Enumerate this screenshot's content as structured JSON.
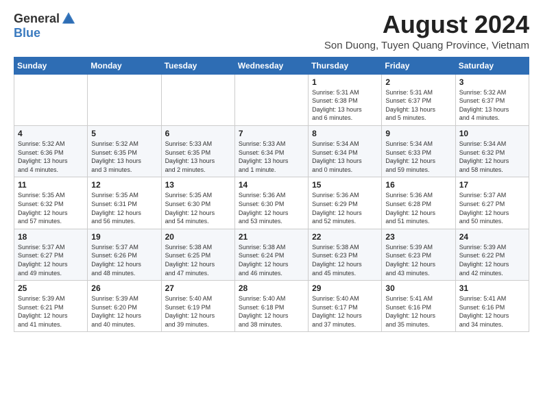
{
  "header": {
    "logo_general": "General",
    "logo_blue": "Blue",
    "month_year": "August 2024",
    "location": "Son Duong, Tuyen Quang Province, Vietnam"
  },
  "weekdays": [
    "Sunday",
    "Monday",
    "Tuesday",
    "Wednesday",
    "Thursday",
    "Friday",
    "Saturday"
  ],
  "weeks": [
    [
      {
        "day": "",
        "info": ""
      },
      {
        "day": "",
        "info": ""
      },
      {
        "day": "",
        "info": ""
      },
      {
        "day": "",
        "info": ""
      },
      {
        "day": "1",
        "info": "Sunrise: 5:31 AM\nSunset: 6:38 PM\nDaylight: 13 hours\nand 6 minutes."
      },
      {
        "day": "2",
        "info": "Sunrise: 5:31 AM\nSunset: 6:37 PM\nDaylight: 13 hours\nand 5 minutes."
      },
      {
        "day": "3",
        "info": "Sunrise: 5:32 AM\nSunset: 6:37 PM\nDaylight: 13 hours\nand 4 minutes."
      }
    ],
    [
      {
        "day": "4",
        "info": "Sunrise: 5:32 AM\nSunset: 6:36 PM\nDaylight: 13 hours\nand 4 minutes."
      },
      {
        "day": "5",
        "info": "Sunrise: 5:32 AM\nSunset: 6:35 PM\nDaylight: 13 hours\nand 3 minutes."
      },
      {
        "day": "6",
        "info": "Sunrise: 5:33 AM\nSunset: 6:35 PM\nDaylight: 13 hours\nand 2 minutes."
      },
      {
        "day": "7",
        "info": "Sunrise: 5:33 AM\nSunset: 6:34 PM\nDaylight: 13 hours\nand 1 minute."
      },
      {
        "day": "8",
        "info": "Sunrise: 5:34 AM\nSunset: 6:34 PM\nDaylight: 13 hours\nand 0 minutes."
      },
      {
        "day": "9",
        "info": "Sunrise: 5:34 AM\nSunset: 6:33 PM\nDaylight: 12 hours\nand 59 minutes."
      },
      {
        "day": "10",
        "info": "Sunrise: 5:34 AM\nSunset: 6:32 PM\nDaylight: 12 hours\nand 58 minutes."
      }
    ],
    [
      {
        "day": "11",
        "info": "Sunrise: 5:35 AM\nSunset: 6:32 PM\nDaylight: 12 hours\nand 57 minutes."
      },
      {
        "day": "12",
        "info": "Sunrise: 5:35 AM\nSunset: 6:31 PM\nDaylight: 12 hours\nand 56 minutes."
      },
      {
        "day": "13",
        "info": "Sunrise: 5:35 AM\nSunset: 6:30 PM\nDaylight: 12 hours\nand 54 minutes."
      },
      {
        "day": "14",
        "info": "Sunrise: 5:36 AM\nSunset: 6:30 PM\nDaylight: 12 hours\nand 53 minutes."
      },
      {
        "day": "15",
        "info": "Sunrise: 5:36 AM\nSunset: 6:29 PM\nDaylight: 12 hours\nand 52 minutes."
      },
      {
        "day": "16",
        "info": "Sunrise: 5:36 AM\nSunset: 6:28 PM\nDaylight: 12 hours\nand 51 minutes."
      },
      {
        "day": "17",
        "info": "Sunrise: 5:37 AM\nSunset: 6:27 PM\nDaylight: 12 hours\nand 50 minutes."
      }
    ],
    [
      {
        "day": "18",
        "info": "Sunrise: 5:37 AM\nSunset: 6:27 PM\nDaylight: 12 hours\nand 49 minutes."
      },
      {
        "day": "19",
        "info": "Sunrise: 5:37 AM\nSunset: 6:26 PM\nDaylight: 12 hours\nand 48 minutes."
      },
      {
        "day": "20",
        "info": "Sunrise: 5:38 AM\nSunset: 6:25 PM\nDaylight: 12 hours\nand 47 minutes."
      },
      {
        "day": "21",
        "info": "Sunrise: 5:38 AM\nSunset: 6:24 PM\nDaylight: 12 hours\nand 46 minutes."
      },
      {
        "day": "22",
        "info": "Sunrise: 5:38 AM\nSunset: 6:23 PM\nDaylight: 12 hours\nand 45 minutes."
      },
      {
        "day": "23",
        "info": "Sunrise: 5:39 AM\nSunset: 6:23 PM\nDaylight: 12 hours\nand 43 minutes."
      },
      {
        "day": "24",
        "info": "Sunrise: 5:39 AM\nSunset: 6:22 PM\nDaylight: 12 hours\nand 42 minutes."
      }
    ],
    [
      {
        "day": "25",
        "info": "Sunrise: 5:39 AM\nSunset: 6:21 PM\nDaylight: 12 hours\nand 41 minutes."
      },
      {
        "day": "26",
        "info": "Sunrise: 5:39 AM\nSunset: 6:20 PM\nDaylight: 12 hours\nand 40 minutes."
      },
      {
        "day": "27",
        "info": "Sunrise: 5:40 AM\nSunset: 6:19 PM\nDaylight: 12 hours\nand 39 minutes."
      },
      {
        "day": "28",
        "info": "Sunrise: 5:40 AM\nSunset: 6:18 PM\nDaylight: 12 hours\nand 38 minutes."
      },
      {
        "day": "29",
        "info": "Sunrise: 5:40 AM\nSunset: 6:17 PM\nDaylight: 12 hours\nand 37 minutes."
      },
      {
        "day": "30",
        "info": "Sunrise: 5:41 AM\nSunset: 6:16 PM\nDaylight: 12 hours\nand 35 minutes."
      },
      {
        "day": "31",
        "info": "Sunrise: 5:41 AM\nSunset: 6:16 PM\nDaylight: 12 hours\nand 34 minutes."
      }
    ]
  ]
}
